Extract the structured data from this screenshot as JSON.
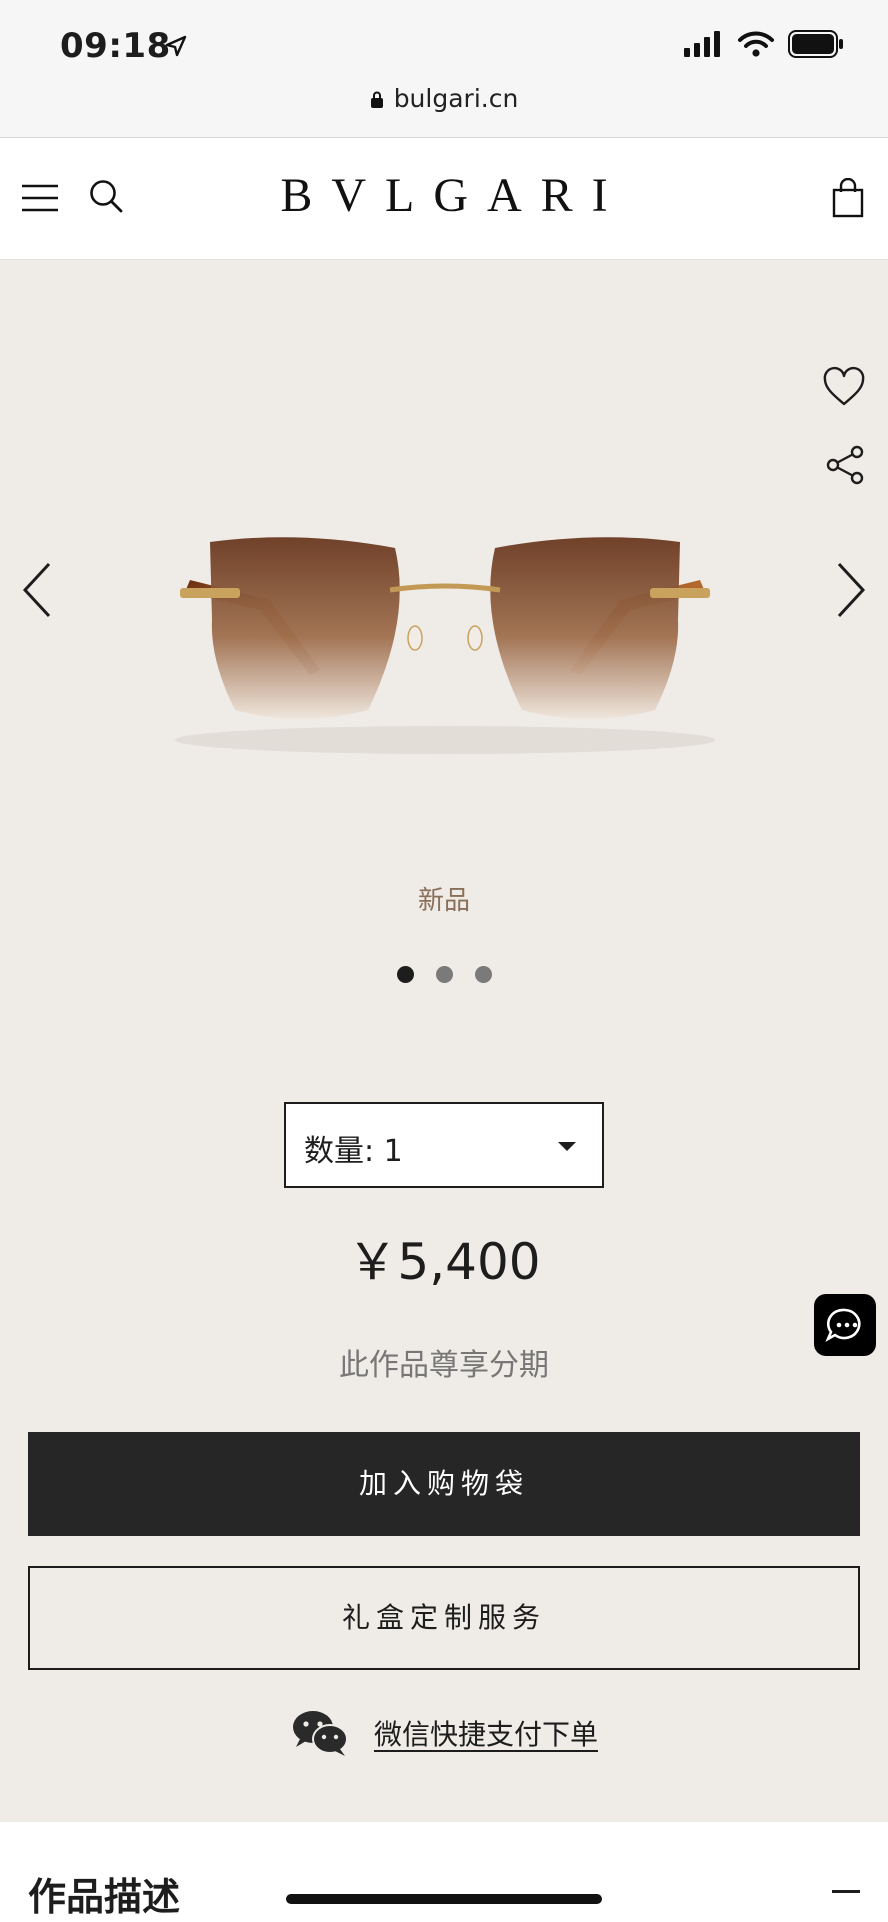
{
  "status_bar": {
    "time": "09:18",
    "url": "bulgari.cn"
  },
  "header": {
    "logo": "BVLGARI"
  },
  "product": {
    "badge": "新品",
    "gallery_dots": 3,
    "quantity_label": "数量:  1",
    "price": "￥5,400",
    "installment": "此作品尊享分期",
    "add_to_bag": "加入购物袋",
    "gift_box": "礼盒定制服务",
    "wechat_pay": "微信快捷支付下单"
  },
  "description": {
    "title": "作品描述"
  },
  "colors": {
    "background": "#efebe6",
    "primary_button": "#262626",
    "badge": "#8a6f5a"
  },
  "icons": [
    "location-arrow-icon",
    "signal-icon",
    "wifi-icon",
    "battery-icon",
    "lock-icon",
    "menu-icon",
    "search-icon",
    "bag-icon",
    "heart-icon",
    "share-icon",
    "chevron-left-icon",
    "chevron-right-icon",
    "chevron-down-icon",
    "chat-icon",
    "wechat-icon",
    "minus-icon"
  ]
}
